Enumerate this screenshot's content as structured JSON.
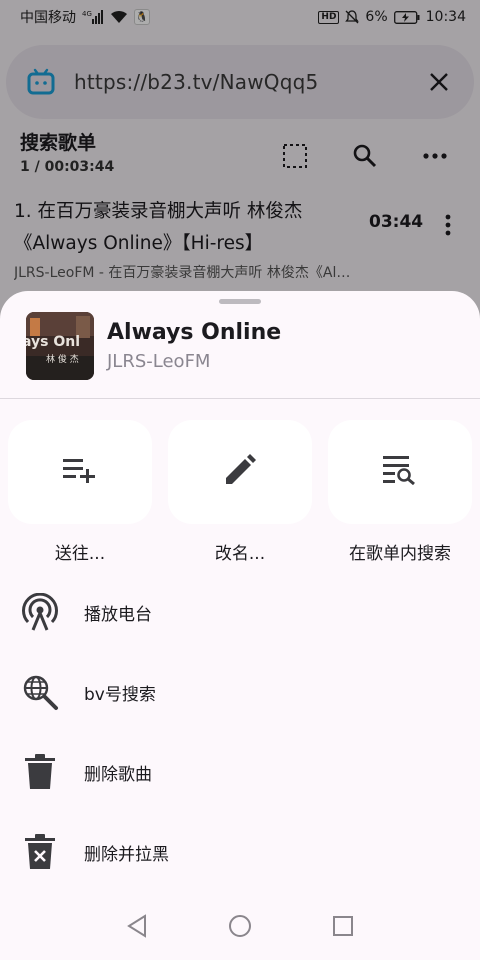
{
  "status_bar": {
    "carrier": "中国移动",
    "network": "4G",
    "battery": "6%",
    "time": "10:34",
    "icons": [
      "signal-icon",
      "wifi-icon",
      "qq-icon",
      "hd-icon",
      "mute-bell-icon",
      "battery-icon"
    ]
  },
  "url_bar": {
    "icon": "bilibili-tv-icon",
    "url": "https://b23.tv/NawQqq5",
    "close_icon": "close-icon"
  },
  "playlist": {
    "title": "搜索歌单",
    "position": "1 / 00:03:44",
    "actions": [
      "select-all-icon",
      "search-icon",
      "more-horiz-icon"
    ]
  },
  "song": {
    "title": "1. 在百万豪装录音棚大声听 林俊杰《Always Online》【Hi-res】",
    "subtitle": "JLRS-LeoFM - 在百万豪装录音棚大声听 林俊杰《Always Online》【Hi-res】",
    "duration": "03:44"
  },
  "sheet": {
    "song_title": "Always Online",
    "artist": "JLRS-LeoFM",
    "actions": [
      {
        "label": "送往...",
        "icon": "playlist-add-icon"
      },
      {
        "label": "改名...",
        "icon": "edit-pencil-icon"
      },
      {
        "label": "在歌单内搜索",
        "icon": "list-search-icon"
      }
    ],
    "menu": [
      {
        "label": "播放电台",
        "icon": "radio-antenna-icon"
      },
      {
        "label": "bv号搜索",
        "icon": "globe-search-icon"
      },
      {
        "label": "删除歌曲",
        "icon": "trash-icon"
      },
      {
        "label": "删除并拉黑",
        "icon": "trash-x-icon"
      }
    ]
  },
  "nav_bar": {
    "icons": [
      "back-triangle-icon",
      "home-circle-icon",
      "recents-square-icon"
    ]
  },
  "colors": {
    "accent_blue": "#1ba0d8",
    "sheet_bg": "#fdf8fc",
    "tile_bg": "#ffffff",
    "icon_dark": "#3b3b3f"
  }
}
